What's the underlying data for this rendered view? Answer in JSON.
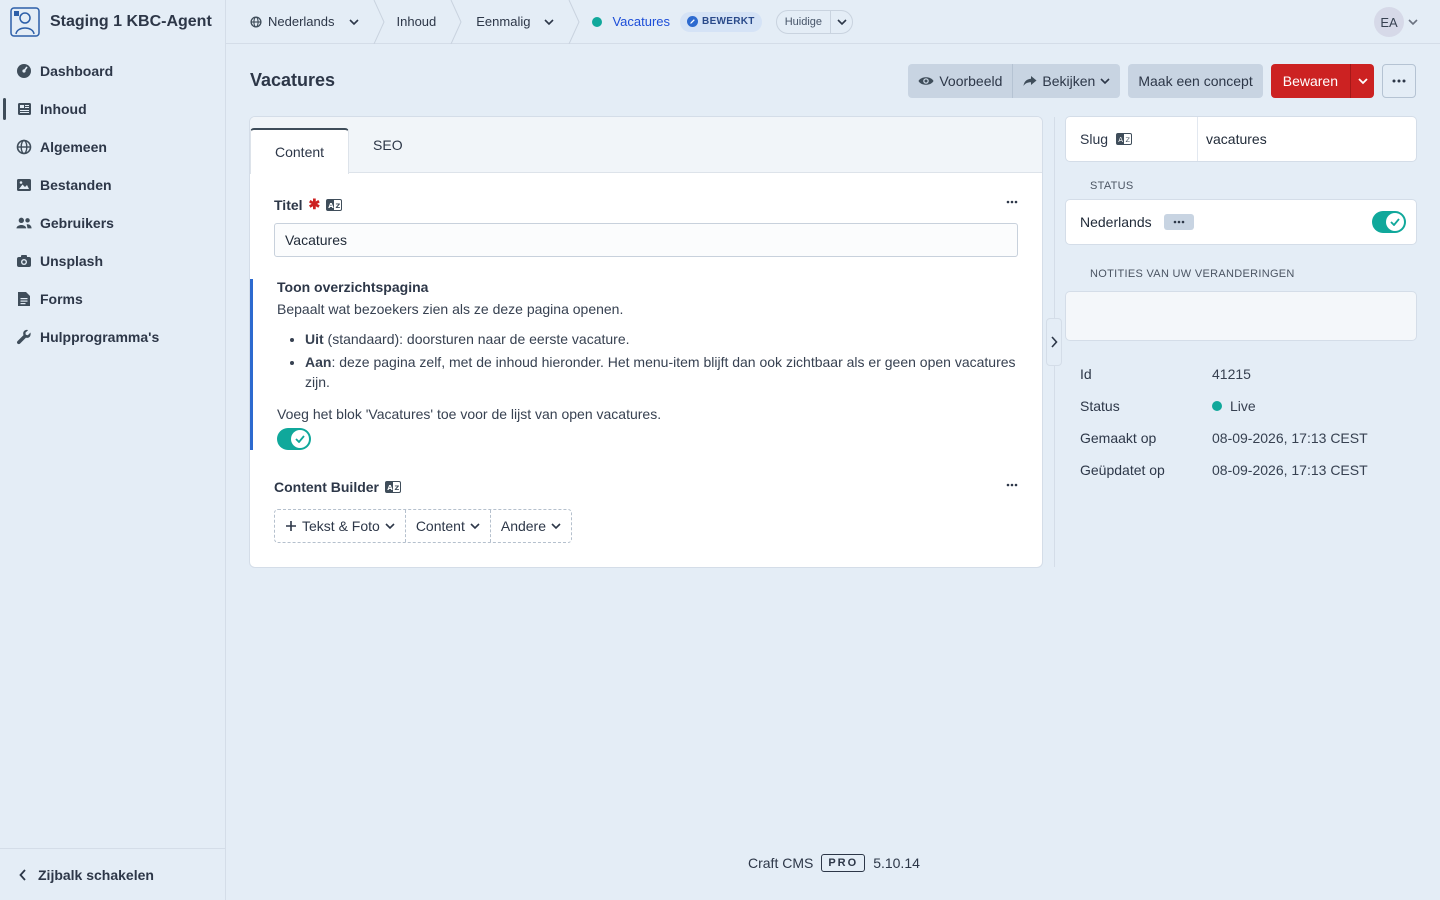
{
  "site": {
    "name": "Staging 1 KBC-Agent"
  },
  "nav": {
    "items": [
      {
        "label": "Dashboard",
        "icon": "gauge-icon"
      },
      {
        "label": "Inhoud",
        "icon": "newspaper-icon",
        "selected": true
      },
      {
        "label": "Algemeen",
        "icon": "globe-icon"
      },
      {
        "label": "Bestanden",
        "icon": "image-icon"
      },
      {
        "label": "Gebruikers",
        "icon": "users-icon"
      },
      {
        "label": "Unsplash",
        "icon": "camera-icon"
      },
      {
        "label": "Forms",
        "icon": "document-icon"
      },
      {
        "label": "Hulpprogramma's",
        "icon": "wrench-icon"
      }
    ],
    "collapse_label": "Zijbalk schakelen"
  },
  "breadcrumbs": {
    "site": "Nederlands",
    "section": "Inhoud",
    "type": "Eenmalig",
    "entry": "Vacatures",
    "edited_badge": "BEWERKT",
    "revision": "Huidige"
  },
  "user": {
    "initials": "EA"
  },
  "page": {
    "title": "Vacatures"
  },
  "actions": {
    "preview": "Voorbeeld",
    "view": "Bekijken",
    "draft": "Maak een concept",
    "save": "Bewaren"
  },
  "tabs": [
    {
      "label": "Content",
      "active": true
    },
    {
      "label": "SEO",
      "active": false
    }
  ],
  "fields": {
    "title": {
      "label": "Titel",
      "value": "Vacatures"
    },
    "instructions": {
      "heading": "Toon overzichtspagina",
      "text": "Bepaalt wat bezoekers zien als ze deze pagina openen.",
      "list": [
        {
          "bold": "Uit",
          "rest": " (standaard): doorsturen naar de eerste vacature."
        },
        {
          "bold": "Aan",
          "rest": ": deze pagina zelf, met de inhoud hieronder. Het menu-item blijft dan ook zichtbaar als er geen open vacatures zijn."
        }
      ],
      "toggle_label": "Voeg het blok 'Vacatures' toe voor de lijst van open vacatures.",
      "toggle_on": true
    },
    "builder": {
      "label": "Content Builder",
      "buttons": [
        "Tekst & Foto",
        "Content",
        "Andere"
      ]
    }
  },
  "details": {
    "slug_label": "Slug",
    "slug_value": "vacatures",
    "status_heading": "STATUS",
    "site_status_label": "Nederlands",
    "site_enabled": true,
    "notes_heading": "NOTITIES VAN UW VERANDERINGEN",
    "notes_value": "",
    "meta": [
      {
        "key": "Id",
        "value": "41215"
      },
      {
        "key": "Status",
        "value": "Live"
      },
      {
        "key": "Gemaakt op",
        "value": "08-09-2026, 17:13 CEST"
      },
      {
        "key": "Geüpdatet op",
        "value": "08-09-2026, 17:13 CEST"
      }
    ]
  },
  "footer": {
    "product": "Craft CMS",
    "edition": "PRO",
    "version": "5.10.14"
  },
  "colors": {
    "accent": "#cc2222",
    "live": "#10a89b",
    "link": "#1d4ed8",
    "background": "#e4edf6"
  }
}
